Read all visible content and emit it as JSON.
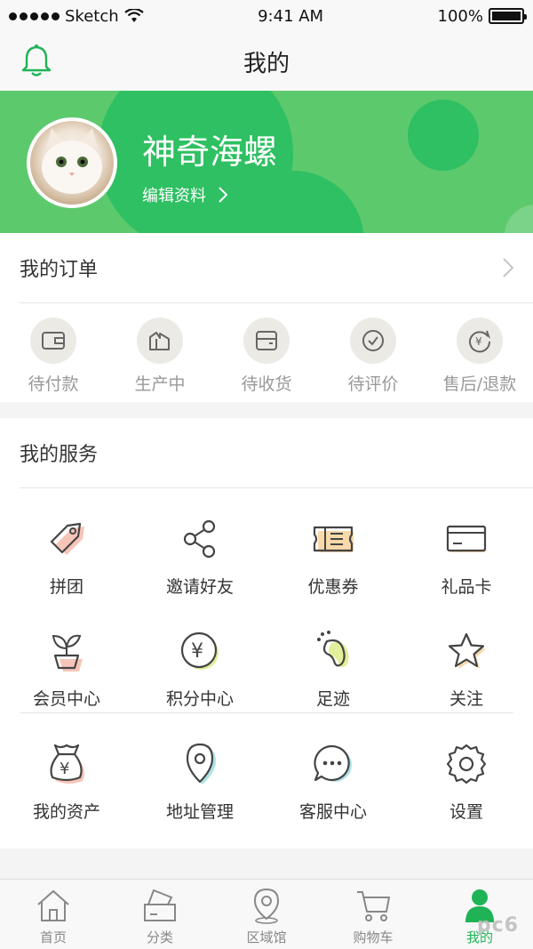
{
  "status_bar": {
    "carrier": "Sketch",
    "time": "9:41 AM",
    "battery": "100%"
  },
  "nav": {
    "title": "我的"
  },
  "profile": {
    "name": "神奇海螺",
    "edit_label": "编辑资料"
  },
  "orders": {
    "title": "我的订单",
    "items": [
      {
        "label": "待付款",
        "icon": "wallet-icon"
      },
      {
        "label": "生产中",
        "icon": "factory-icon"
      },
      {
        "label": "待收货",
        "icon": "box-icon"
      },
      {
        "label": "待评价",
        "icon": "check-circle-icon"
      },
      {
        "label": "售后/退款",
        "icon": "refund-icon"
      }
    ]
  },
  "services": {
    "title": "我的服务",
    "items": [
      {
        "label": "拼团",
        "icon": "tag-icon"
      },
      {
        "label": "邀请好友",
        "icon": "share-icon"
      },
      {
        "label": "优惠券",
        "icon": "coupon-icon"
      },
      {
        "label": "礼品卡",
        "icon": "card-icon"
      },
      {
        "label": "会员中心",
        "icon": "plant-icon"
      },
      {
        "label": "积分中心",
        "icon": "yen-coin-icon"
      },
      {
        "label": "足迹",
        "icon": "footprint-icon"
      },
      {
        "label": "关注",
        "icon": "star-icon"
      },
      {
        "label": "我的资产",
        "icon": "money-bag-icon"
      },
      {
        "label": "地址管理",
        "icon": "location-pin-icon"
      },
      {
        "label": "客服中心",
        "icon": "chat-bubble-icon"
      },
      {
        "label": "设置",
        "icon": "gear-icon"
      }
    ]
  },
  "tab_bar": {
    "items": [
      {
        "label": "首页",
        "icon": "home-icon"
      },
      {
        "label": "分类",
        "icon": "category-icon"
      },
      {
        "label": "区域馆",
        "icon": "map-pin-icon"
      },
      {
        "label": "购物车",
        "icon": "cart-icon"
      },
      {
        "label": "我的",
        "icon": "user-icon",
        "active": true
      }
    ]
  },
  "colors": {
    "brand_green": "#5dc96d",
    "active_tab": "#1fb356"
  },
  "watermark": "pc6"
}
